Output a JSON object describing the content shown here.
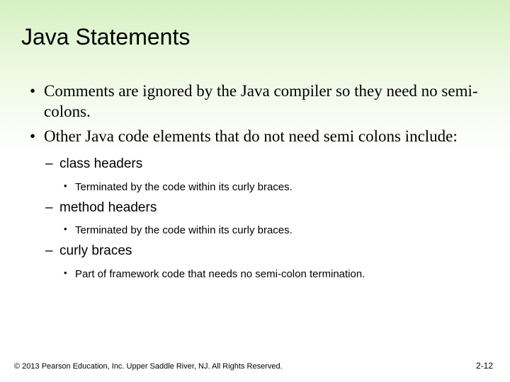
{
  "title": "Java Statements",
  "bullets": {
    "b1": "Comments are ignored by the Java compiler so they need no semi-colons.",
    "b2": "Other Java code elements that do not need semi colons include:",
    "sub": {
      "s1": {
        "label": "class headers",
        "detail": "Terminated by the code within its curly braces."
      },
      "s2": {
        "label": "method headers",
        "detail": "Terminated by the code within its curly braces."
      },
      "s3": {
        "label": "curly braces",
        "detail": "Part of framework code that needs no semi-colon termination."
      }
    }
  },
  "footer": {
    "copyright": "© 2013 Pearson Education, Inc. Upper Saddle River, NJ. All Rights Reserved.",
    "page": "2-12"
  }
}
